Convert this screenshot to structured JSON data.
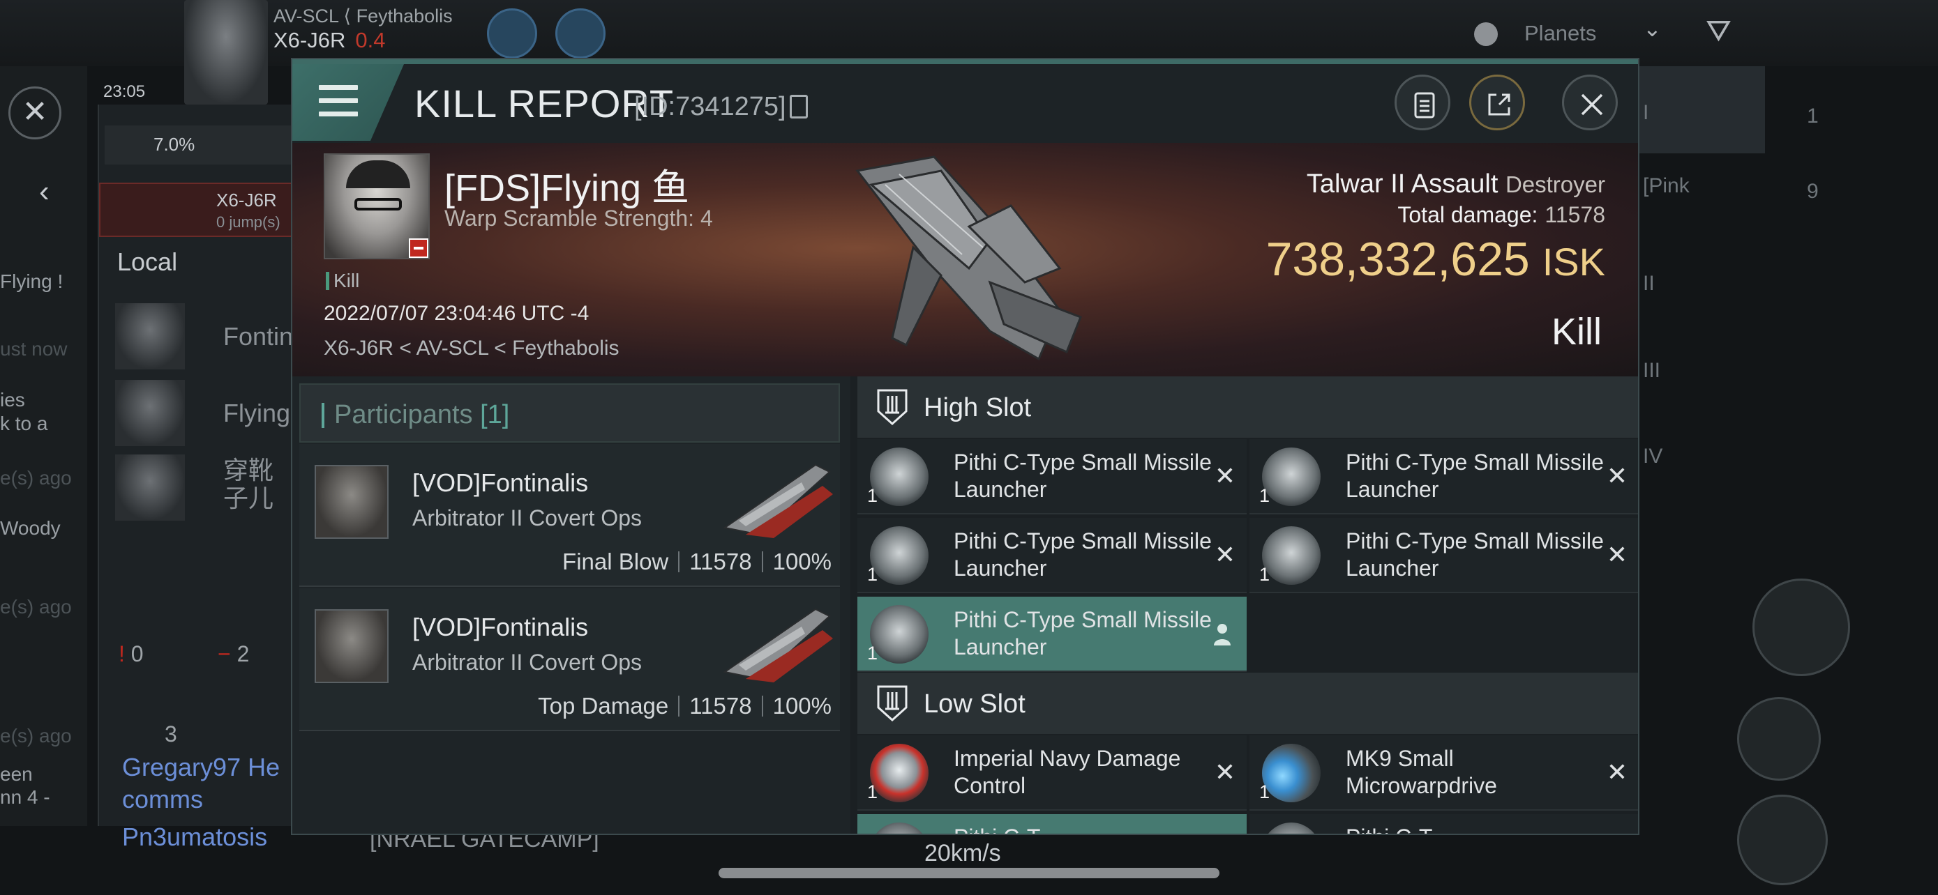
{
  "background": {
    "system_path": "AV-SCL ⟨ Feythabolis",
    "system": "X6-J6R",
    "security": "0.4",
    "time": "23:05",
    "cargo_pct": "7.0%",
    "autopilot_dest": "X6-J6R",
    "autopilot_jumps": "0 jump(s)",
    "local_title": "Local",
    "local_members": [
      "Fontin",
      "Flying",
      "穿靴子儿"
    ],
    "count_red": "0",
    "count_minus": "2",
    "people_count": "3",
    "left_snippets": [
      "Flying !",
      "ust now",
      "ies",
      "k to a",
      "e(s) ago",
      "Woody",
      "e(s) ago",
      "e(s) ago",
      "een",
      "nn 4 -"
    ],
    "chat_line1": "Gregary97 He",
    "chat_line2": "comms",
    "chat_line3": "Pn3umatosis",
    "gatecamp": "[NRAEL GATECAMP]",
    "speed": "20km/s",
    "planets_label": "Planets",
    "right_items": [
      "I",
      "[Pink",
      "II",
      "III",
      "IV"
    ],
    "right_counts": [
      "1",
      "9"
    ]
  },
  "dialog": {
    "title": "KILL REPORT",
    "id_label": "[ID:7341275]",
    "victim": {
      "name": "[FDS]Flying 鱼",
      "scramble": "Warp Scramble Strength: 4",
      "kill_tag": "Kill",
      "datetime": "2022/07/07 23:04:46 UTC -4",
      "location": "X6-J6R < AV-SCL < Feythabolis"
    },
    "ship": {
      "name": "Talwar II Assault",
      "class": "Destroyer",
      "total_damage_label": "Total damage:",
      "total_damage": "11578",
      "isk_value": "738,332,625",
      "isk_unit": "ISK",
      "result": "Kill"
    },
    "participants": {
      "label": "Participants",
      "count": "[1]",
      "rows": [
        {
          "name": "[VOD]Fontinalis",
          "ship": "Arbitrator II Covert Ops",
          "role": "Final Blow",
          "damage": "11578",
          "pct": "100%"
        },
        {
          "name": "[VOD]Fontinalis",
          "ship": "Arbitrator II Covert Ops",
          "role": "Top Damage",
          "damage": "11578",
          "pct": "100%"
        }
      ]
    },
    "high_slot": {
      "label": "High Slot",
      "modules": [
        {
          "qty": "1",
          "name": "Pithi C-Type Small Missile Launcher",
          "state": "destroyed"
        },
        {
          "qty": "1",
          "name": "Pithi C-Type Small Missile Launcher",
          "state": "destroyed"
        },
        {
          "qty": "1",
          "name": "Pithi C-Type Small Missile Launcher",
          "state": "destroyed"
        },
        {
          "qty": "1",
          "name": "Pithi C-Type Small Missile Launcher",
          "state": "destroyed"
        },
        {
          "qty": "1",
          "name": "Pithi C-Type Small Missile Launcher",
          "state": "dropped"
        }
      ]
    },
    "low_slot": {
      "label": "Low Slot",
      "modules": [
        {
          "qty": "1",
          "name": "Imperial Navy Damage Control",
          "state": "destroyed"
        },
        {
          "qty": "1",
          "name": "MK9 Small Microwarpdrive",
          "state": "destroyed"
        },
        {
          "qty": "",
          "name": "Pithi C-T",
          "state": "dropped"
        },
        {
          "qty": "",
          "name": "Pithi C-T",
          "state": "destroyed"
        }
      ]
    }
  },
  "colors": {
    "accent": "#467a71",
    "isk": "#efcf8a",
    "danger": "#c0281f"
  }
}
